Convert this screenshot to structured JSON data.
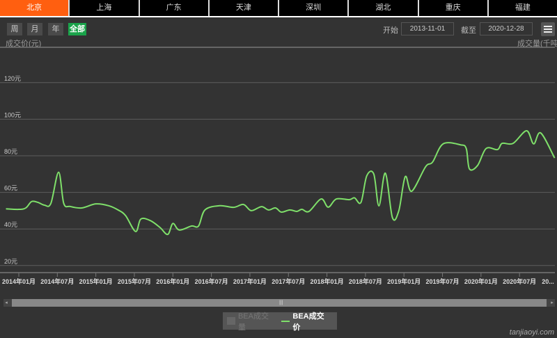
{
  "tabs": [
    "北京",
    "上海",
    "广东",
    "天津",
    "深圳",
    "湖北",
    "重庆",
    "福建"
  ],
  "active_tab": 0,
  "range_buttons": [
    "周",
    "月",
    "年",
    "全部"
  ],
  "active_range": 3,
  "start_label": "开始",
  "start_date": "2013-11-01",
  "end_label": "截至",
  "end_date": "2020-12-28",
  "menu_icon": "hamburger-menu-icon",
  "colors": {
    "accent": "#ff5f10",
    "active_range": "#1aa34a",
    "line": "#7fe06a",
    "background": "#333333"
  },
  "watermark": "tanjiaoyi.com",
  "chart_data": {
    "type": "line",
    "ylabel": "成交价(元)",
    "ylabel_right": "成交量(千吨)",
    "y_ticks": [
      "20元",
      "40元",
      "60元",
      "80元",
      "100元",
      "120元"
    ],
    "y_tick_values": [
      20,
      40,
      60,
      80,
      100,
      120
    ],
    "ylim": [
      20,
      140
    ],
    "grid": true,
    "x_ticks": [
      "2014年01月",
      "2014年07月",
      "2015年01月",
      "2015年07月",
      "2016年01月",
      "2016年07月",
      "2017年01月",
      "2017年07月",
      "2018年01月",
      "2018年07月",
      "2019年01月",
      "2019年07月",
      "2020年01月",
      "2020年07月",
      "20..."
    ],
    "legend_position": "bottom",
    "legend": [
      {
        "name": "BEA成交量",
        "enabled": false
      },
      {
        "name": "BEA成交价",
        "enabled": true
      }
    ],
    "series": [
      {
        "name": "BEA成交价",
        "points": [
          [
            "2013-11-01",
            51
          ],
          [
            "2014-01-01",
            50.7
          ],
          [
            "2014-02-04",
            51.5
          ],
          [
            "2014-03-01",
            55
          ],
          [
            "2014-04-01",
            54.5
          ],
          [
            "2014-05-01",
            53
          ],
          [
            "2014-06-01",
            54
          ],
          [
            "2014-07-07",
            71
          ],
          [
            "2014-08-01",
            54
          ],
          [
            "2014-09-01",
            52.3
          ],
          [
            "2014-10-25",
            51.5
          ],
          [
            "2015-01-01",
            53.7
          ],
          [
            "2015-03-01",
            52.7
          ],
          [
            "2015-04-15",
            50.4
          ],
          [
            "2015-05-20",
            47.3
          ],
          [
            "2015-07-07",
            38.6
          ],
          [
            "2015-08-01",
            45.4
          ],
          [
            "2015-09-15",
            44.6
          ],
          [
            "2015-11-01",
            40.8
          ],
          [
            "2015-12-07",
            37
          ],
          [
            "2016-01-01",
            43
          ],
          [
            "2016-02-01",
            39.4
          ],
          [
            "2016-03-28",
            41.6
          ],
          [
            "2016-05-01",
            41.6
          ],
          [
            "2016-06-01",
            50.4
          ],
          [
            "2016-08-10",
            52.7
          ],
          [
            "2016-10-15",
            51.8
          ],
          [
            "2016-12-01",
            53.4
          ],
          [
            "2017-01-07",
            50
          ],
          [
            "2017-02-25",
            52.2
          ],
          [
            "2017-03-28",
            50.4
          ],
          [
            "2017-05-01",
            51.5
          ],
          [
            "2017-05-28",
            49.2
          ],
          [
            "2017-07-07",
            50.4
          ],
          [
            "2017-08-10",
            49.6
          ],
          [
            "2017-09-04",
            50.7
          ],
          [
            "2017-10-07",
            49.6
          ],
          [
            "2017-12-04",
            56.4
          ],
          [
            "2018-01-07",
            51.9
          ],
          [
            "2018-02-15",
            56.4
          ],
          [
            "2018-04-15",
            56
          ],
          [
            "2018-05-10",
            57
          ],
          [
            "2018-06-10",
            54.5
          ],
          [
            "2018-07-07",
            69
          ],
          [
            "2018-08-10",
            70
          ],
          [
            "2018-09-04",
            52.6
          ],
          [
            "2018-10-04",
            70.5
          ],
          [
            "2018-11-07",
            46.2
          ],
          [
            "2018-12-07",
            50
          ],
          [
            "2019-01-07",
            68.6
          ],
          [
            "2019-02-07",
            60.6
          ],
          [
            "2019-04-12",
            74
          ],
          [
            "2019-05-15",
            76.6
          ],
          [
            "2019-07-04",
            86.5
          ],
          [
            "2019-09-25",
            86
          ],
          [
            "2019-10-22",
            84
          ],
          [
            "2019-11-07",
            72.8
          ],
          [
            "2019-12-15",
            74.7
          ],
          [
            "2020-01-25",
            84
          ],
          [
            "2020-03-18",
            83.4
          ],
          [
            "2020-04-10",
            86.8
          ],
          [
            "2020-06-01",
            86.8
          ],
          [
            "2020-08-04",
            93.7
          ],
          [
            "2020-09-07",
            86.5
          ],
          [
            "2020-10-10",
            92.5
          ],
          [
            "2020-12-15",
            78.8
          ]
        ]
      }
    ]
  }
}
